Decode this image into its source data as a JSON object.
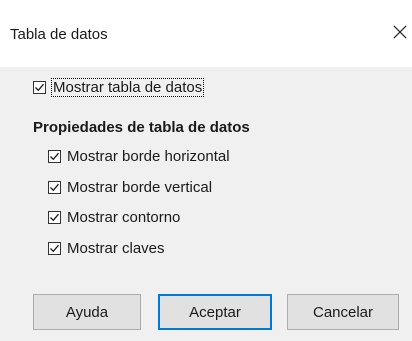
{
  "window": {
    "title": "Tabla de datos",
    "close_glyph": "×"
  },
  "show_table": {
    "label": "Mostrar tabla de datos",
    "checked": true
  },
  "properties": {
    "heading": "Propiedades de tabla de datos",
    "options": [
      {
        "label": "Mostrar borde horizontal",
        "checked": true
      },
      {
        "label": "Mostrar borde vertical",
        "checked": true
      },
      {
        "label": "Mostrar contorno",
        "checked": true
      },
      {
        "label": "Mostrar claves",
        "checked": true
      }
    ]
  },
  "buttons": {
    "help": "Ayuda",
    "ok": "Aceptar",
    "cancel": "Cancelar"
  },
  "colors": {
    "default_button_border": "#0078d7"
  }
}
